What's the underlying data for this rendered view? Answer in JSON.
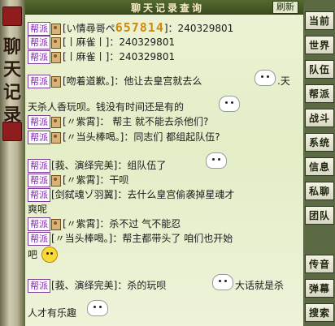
{
  "window": {
    "title": "聊天记录查询",
    "refresh_label": "刷新"
  },
  "left_scroll": {
    "glyphs": [
      "聊",
      "天",
      "记",
      "录"
    ]
  },
  "tag_label": "帮派",
  "messages": [
    {
      "speaker": "[い情尋哥ぺ",
      "gold": "657814",
      "text": "]：240329801"
    },
    {
      "speaker": "[丨麻雀丨]",
      "text": "：240329801"
    },
    {
      "speaker": "[丨麻雀丨]",
      "text": "：240329801"
    },
    {
      "speaker": "[吻着道歉。]",
      "text": "：他让去皇宫就去么",
      "text_after": ".天"
    },
    {
      "continuation": "天杀人香玩呗。钱没有时间还是有的"
    },
    {
      "speaker": "[〃紫霄]",
      "text": "： 帮主 就不能去杀他们?"
    },
    {
      "speaker": "[〃当头棒喝。]",
      "text": "：同志们 都组起队伍?"
    },
    {
      "speaker": "[莪、演绎完美]",
      "text": "：组队伍了"
    },
    {
      "speaker": "[〃紫霄]",
      "text": "：干呗"
    },
    {
      "speaker": "[剑弑魂ゾ羽翼]",
      "text": "：去什么皇宫偷袭掉星魂才"
    },
    {
      "continuation": "爽呢"
    },
    {
      "speaker": "[〃紫霄]",
      "text": "：杀不过 气不能忍"
    },
    {
      "speaker": "[〃当头棒喝。]",
      "text": "：帮主都带头了 咱们也开始"
    },
    {
      "continuation": "吧"
    },
    {
      "speaker": "[莪、演绎完美]",
      "text": "：杀的玩呗",
      "text_after": "大话就是杀"
    },
    {
      "continuation": "人才有乐趣"
    }
  ],
  "nav_tabs": [
    "当前",
    "世界",
    "队伍",
    "帮派",
    "战斗",
    "系统",
    "信息",
    "私聊",
    "团队",
    "传音",
    "弹幕",
    "搜索"
  ],
  "colors": {
    "tag_purple": "#7a20a8",
    "gold": "#cf8a0c",
    "title_bar": "#3b4c1e"
  }
}
